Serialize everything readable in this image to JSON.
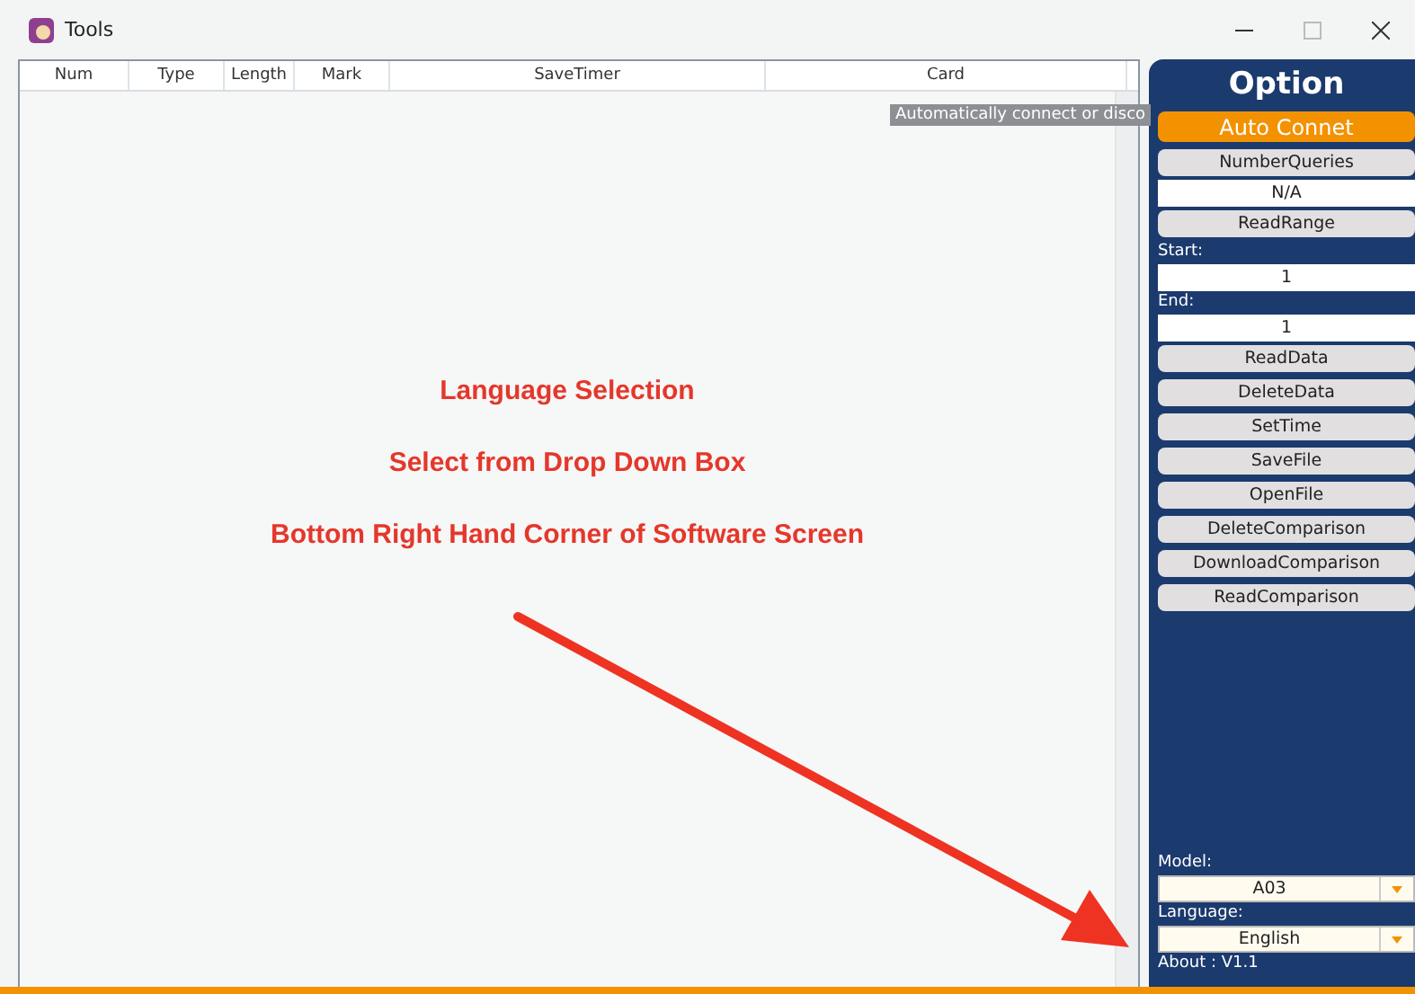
{
  "window": {
    "title": "Tools"
  },
  "table": {
    "columns": [
      "Num",
      "Type",
      "Length",
      "Mark",
      "SaveTimer",
      "Card"
    ]
  },
  "tooltip": "Automatically connect or disco",
  "annotation": {
    "lines": [
      "Language Selection",
      "Select from Drop Down Box",
      "Bottom Right Hand Corner of Software Screen"
    ]
  },
  "panel": {
    "title": "Option",
    "items": [
      {
        "kind": "primary",
        "label": "Auto Connet"
      },
      {
        "kind": "button",
        "label": "NumberQueries"
      },
      {
        "kind": "value",
        "value": "N/A"
      },
      {
        "kind": "button",
        "label": "ReadRange"
      },
      {
        "kind": "label",
        "label": "Start:"
      },
      {
        "kind": "value",
        "value": "1"
      },
      {
        "kind": "label",
        "label": "End:"
      },
      {
        "kind": "value",
        "value": "1"
      },
      {
        "kind": "button",
        "label": "ReadData"
      },
      {
        "kind": "button",
        "label": "DeleteData"
      },
      {
        "kind": "button",
        "label": "SetTime"
      },
      {
        "kind": "button",
        "label": "SaveFile"
      },
      {
        "kind": "button",
        "label": "OpenFile"
      },
      {
        "kind": "button",
        "label": "DeleteComparison"
      },
      {
        "kind": "button",
        "label": "DownloadComparison"
      },
      {
        "kind": "button",
        "label": "ReadComparison"
      }
    ],
    "bottom": [
      {
        "kind": "label",
        "label": "Model:"
      },
      {
        "kind": "select",
        "value": "A03"
      },
      {
        "kind": "label",
        "label": "Language:"
      },
      {
        "kind": "select",
        "value": "English"
      },
      {
        "kind": "label",
        "label": "About : V1.1"
      }
    ]
  }
}
